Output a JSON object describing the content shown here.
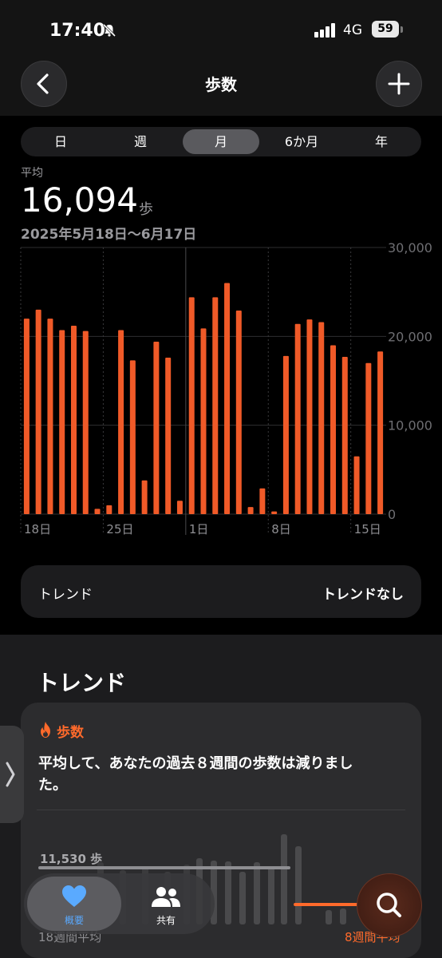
{
  "status_bar": {
    "time": "17:40",
    "carrier": "4G",
    "battery": "59"
  },
  "header": {
    "title": "歩数",
    "back_icon": "chevron-left-icon",
    "add_icon": "plus-icon"
  },
  "segmented_control": {
    "options": [
      "日",
      "週",
      "月",
      "6か月",
      "年"
    ],
    "selected": "月"
  },
  "summary": {
    "label": "平均",
    "value": "16,094",
    "unit": "歩",
    "date_range": "2025年5月18日〜6月17日"
  },
  "chart_data": {
    "type": "bar",
    "title": "",
    "xlabel": "",
    "ylabel": "",
    "ylim": [
      0,
      30000
    ],
    "y_ticks": [
      "30,000",
      "20,000",
      "10,000",
      "0"
    ],
    "x_tick_labels": [
      "18日",
      "25日",
      "1日",
      "8日",
      "15日"
    ],
    "bar_color": "#f05a28",
    "categories": [
      "5/18",
      "5/19",
      "5/20",
      "5/21",
      "5/22",
      "5/23",
      "5/24",
      "5/25",
      "5/26",
      "5/27",
      "5/28",
      "5/29",
      "5/30",
      "5/31",
      "6/1",
      "6/2",
      "6/3",
      "6/4",
      "6/5",
      "6/6",
      "6/7",
      "6/8",
      "6/9",
      "6/10",
      "6/11",
      "6/12",
      "6/13",
      "6/14",
      "6/15",
      "6/16",
      "6/17"
    ],
    "values": [
      22000,
      23000,
      22000,
      20700,
      21200,
      20600,
      600,
      1000,
      20700,
      17300,
      3800,
      19400,
      17600,
      1500,
      24400,
      20900,
      24400,
      26000,
      22900,
      800,
      2900,
      300,
      17800,
      21400,
      21900,
      21600,
      19000,
      17700,
      6500,
      17000,
      18300
    ]
  },
  "trend_row": {
    "label": "トレンド",
    "value": "トレンドなし"
  },
  "trend_section": {
    "heading": "トレンド",
    "card": {
      "category": "歩数",
      "category_icon": "flame-icon",
      "message": "平均して、あなたの過去８週間の歩数は減りました。",
      "mini_value": "11,530 歩",
      "left_label": "18週間平均",
      "right_label": "8週間平均"
    }
  },
  "tab_bar": {
    "summary_label": "概要",
    "summary_icon": "heart-icon",
    "sharing_label": "共有",
    "sharing_icon": "people-icon",
    "search_icon": "search-icon"
  },
  "side_handle": {
    "icon": "chevron-right-icon"
  },
  "colors": {
    "accent_orange": "#ff6a2b",
    "accent_blue": "#5aaaff"
  }
}
